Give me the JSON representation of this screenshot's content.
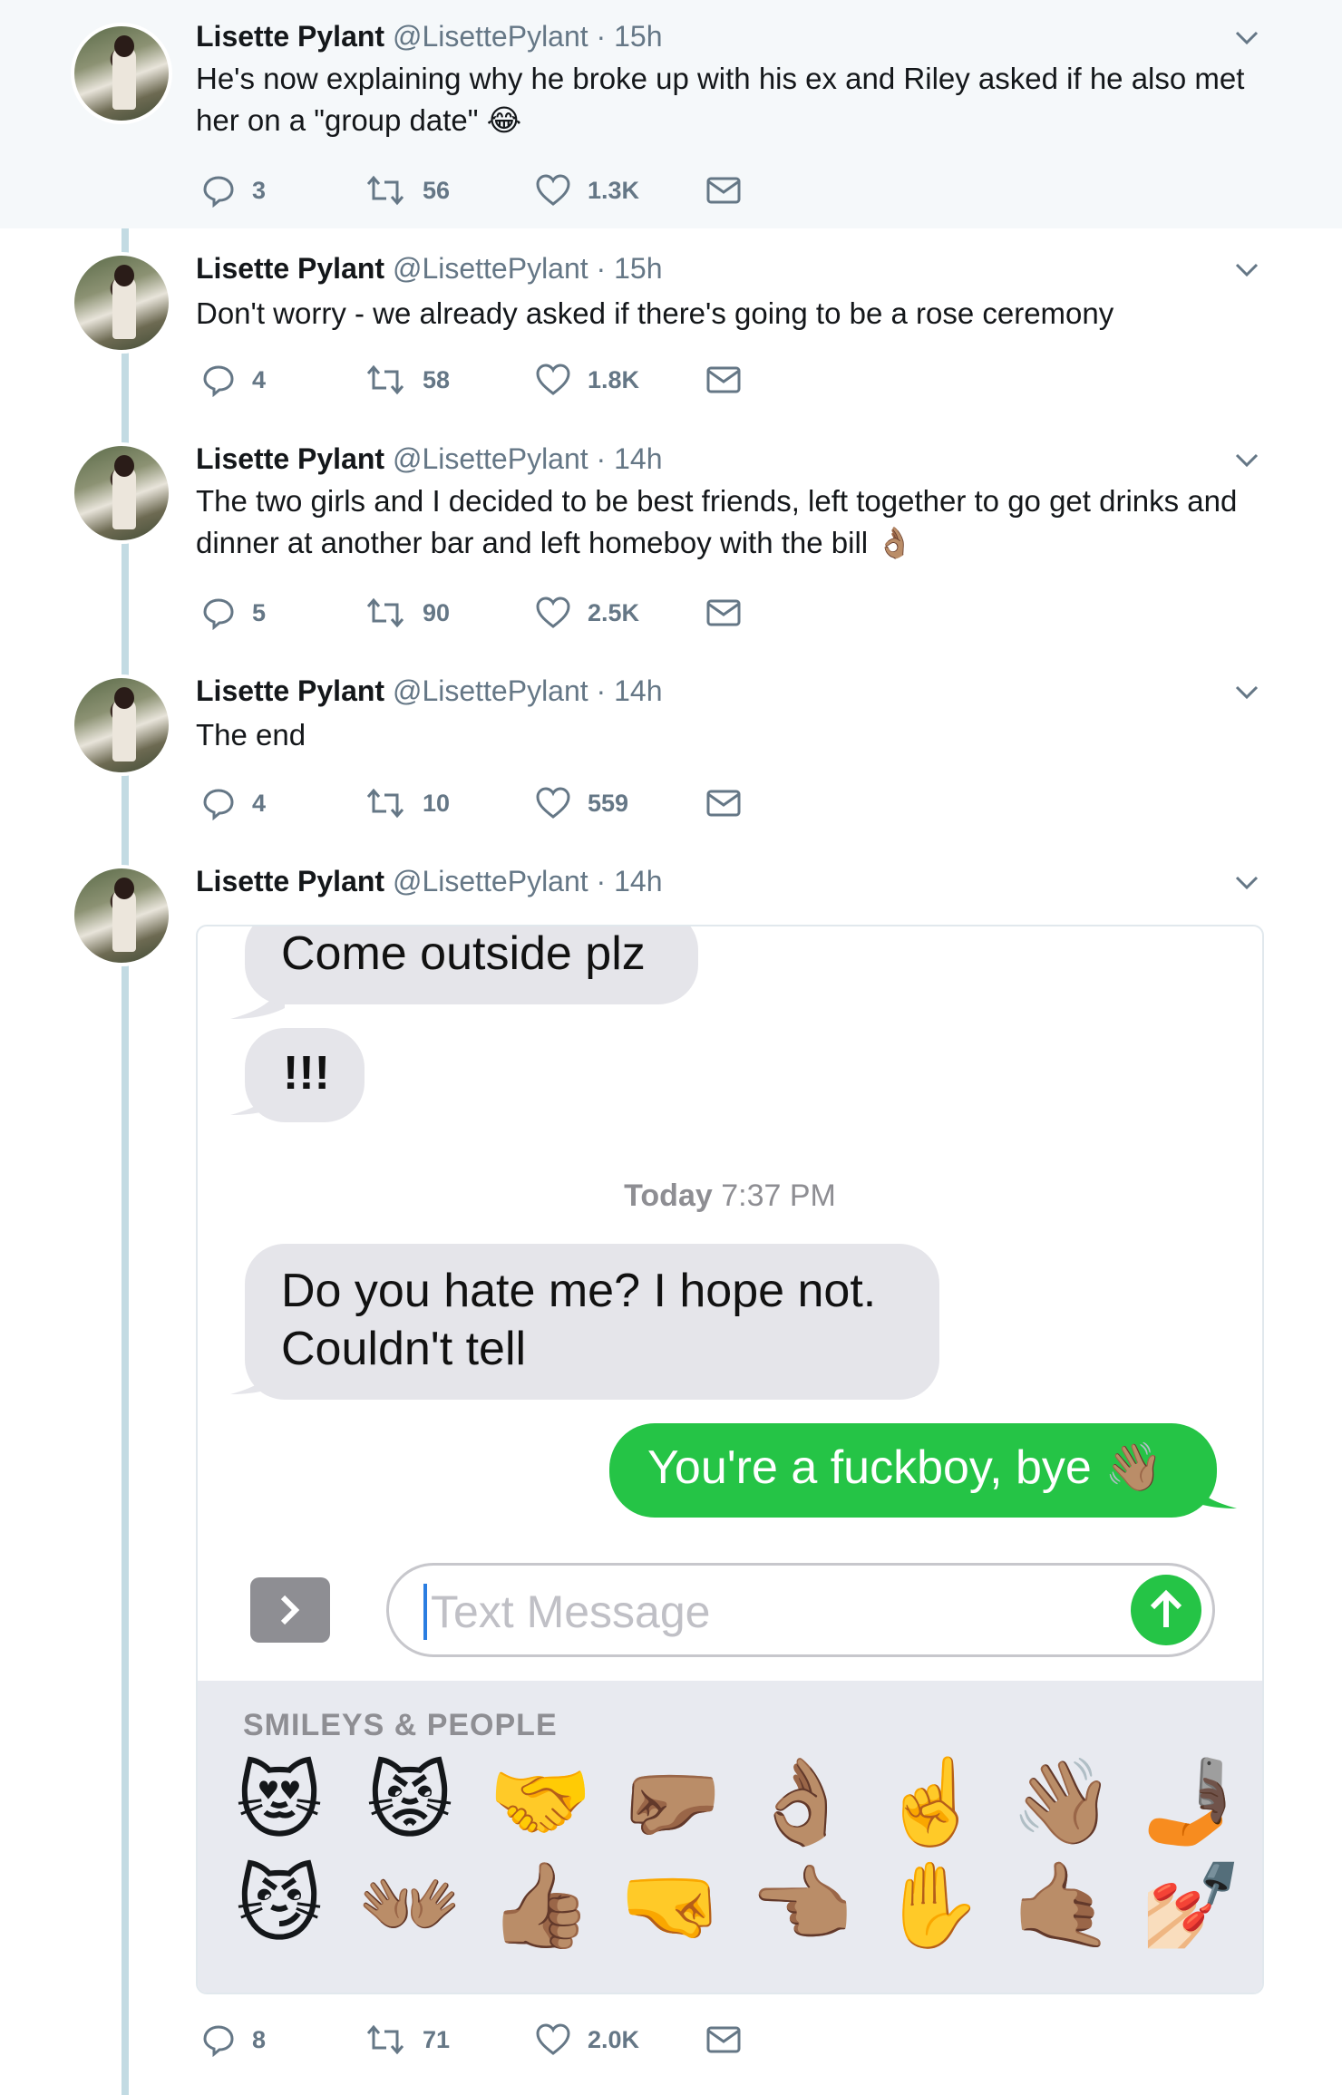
{
  "tweets": [
    {
      "name": "Lisette Pylant",
      "handle": "@LisettePylant",
      "time": "· 15h",
      "text": "He's now explaining why he broke up with his ex and Riley asked if he also met her on a \"group date\" 😂",
      "replies": "3",
      "retweets": "56",
      "likes": "1.3K"
    },
    {
      "name": "Lisette Pylant",
      "handle": "@LisettePylant",
      "time": "· 15h",
      "text": "Don't worry - we already asked if there's going to be a rose ceremony",
      "replies": "4",
      "retweets": "58",
      "likes": "1.8K"
    },
    {
      "name": "Lisette Pylant",
      "handle": "@LisettePylant",
      "time": "· 14h",
      "text": "The two girls and I decided to be best friends, left together to go get drinks and dinner at another bar and left homeboy with the bill 👌🏽",
      "replies": "5",
      "retweets": "90",
      "likes": "2.5K"
    },
    {
      "name": "Lisette Pylant",
      "handle": "@LisettePylant",
      "time": "· 14h",
      "text": "The end",
      "replies": "4",
      "retweets": "10",
      "likes": "559"
    },
    {
      "name": "Lisette Pylant",
      "handle": "@LisettePylant",
      "time": "· 14h",
      "text": "",
      "replies": "8",
      "retweets": "71",
      "likes": "2.0K"
    }
  ],
  "screenshot": {
    "messages": {
      "in1": "Come outside plz",
      "in2": "!!!",
      "timestamp_day": "Today",
      "timestamp_time": "7:37 PM",
      "in3_line1": "Do you hate me? I hope not.",
      "in3_line2": "Couldn't tell",
      "out1": "You're a fuckboy, bye 👋🏽"
    },
    "input_placeholder": "Text Message",
    "keyboard_title": "SMILEYS & PEOPLE",
    "emojis_row1": [
      "😻",
      "😾",
      "🤝",
      "🤛🏽",
      "👌🏽",
      "☝️",
      "👋🏽",
      "🤳🏿"
    ],
    "emojis_row2": [
      "😼",
      "👐🏽",
      "👍🏽",
      "🤜",
      "👈🏽",
      "✋",
      "🤙🏽",
      "💅🏻"
    ]
  },
  "colors": {
    "imessage_green": "#25c446",
    "imessage_gray": "#e5e5ea",
    "twitter_meta": "#657786",
    "thread_line": "#c3dbe3"
  },
  "icons": [
    "reply-icon",
    "retweet-icon",
    "like-icon",
    "direct-message-icon",
    "chevron-down-icon",
    "send-arrow-icon",
    "app-drawer-icon"
  ]
}
